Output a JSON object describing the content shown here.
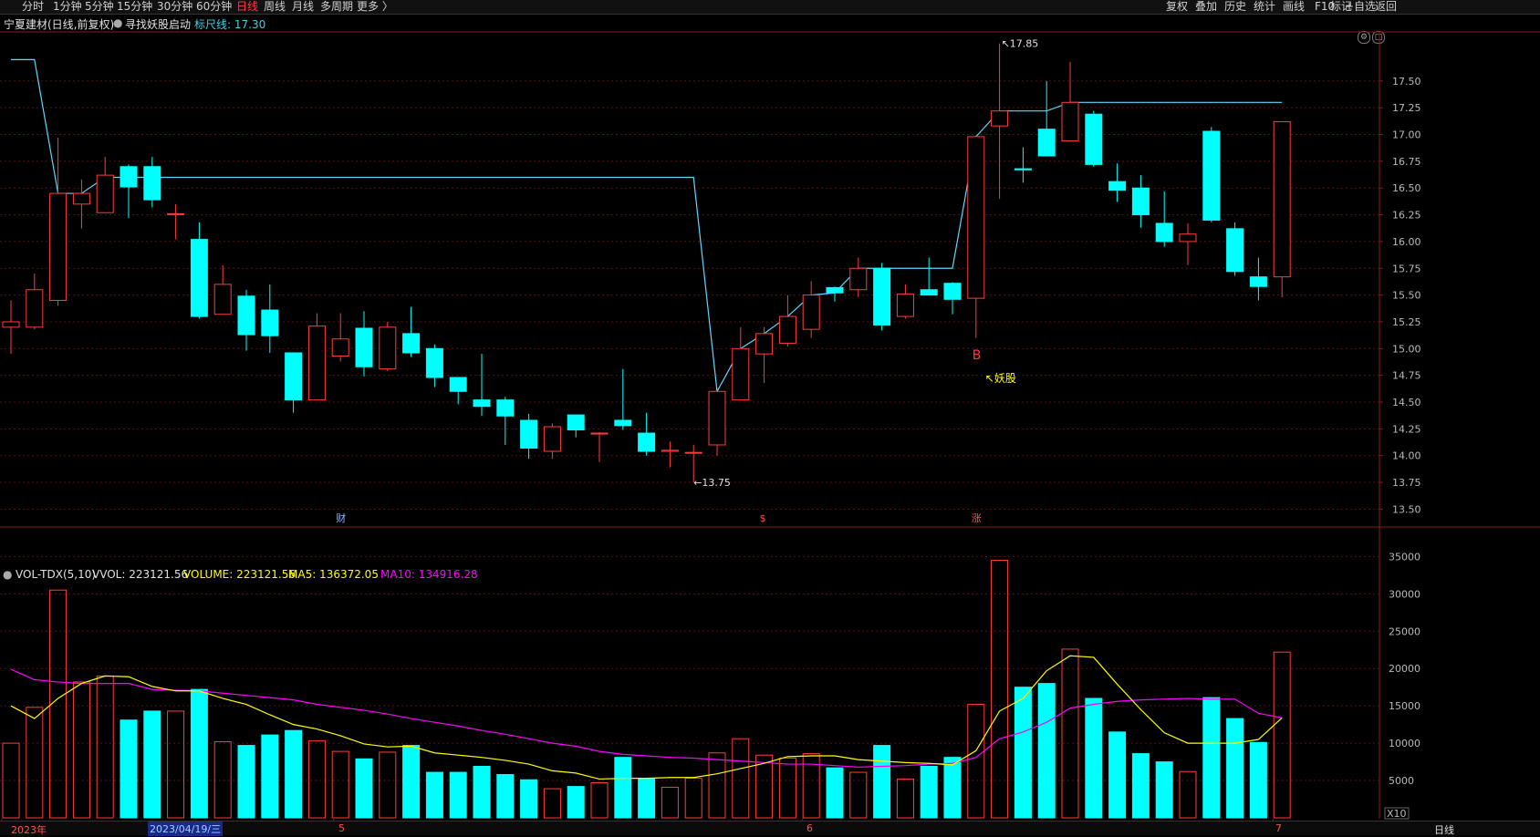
{
  "topbar": {
    "periods": [
      "分时",
      "1分钟",
      "5分钟",
      "15分钟",
      "30分钟",
      "60分钟",
      "日线",
      "周线",
      "月线",
      "多周期",
      "更多 〉"
    ],
    "active_period": "日线",
    "tools": [
      "复权",
      "叠加",
      "历史",
      "统计",
      "画线",
      "F10",
      "+自选",
      "返回"
    ],
    "mark_label": "标记"
  },
  "header": {
    "stock": "宁夏建材(日线,前复权)",
    "indicator": "寻找妖股启动",
    "ruler_label": "标尺线: 17.30"
  },
  "price_axis": [
    "17.50",
    "17.25",
    "17.00",
    "16.75",
    "16.50",
    "16.25",
    "16.00",
    "15.75",
    "15.50",
    "15.25",
    "15.00",
    "14.75",
    "14.50",
    "14.25",
    "14.00",
    "13.75",
    "13.50"
  ],
  "vol_axis": [
    "35000",
    "30000",
    "25000",
    "20000",
    "15000",
    "10000",
    "5000"
  ],
  "annotations": {
    "high": "17.85",
    "low": "13.75",
    "signal": "B",
    "signal_note": "↖妖股",
    "markers": [
      "财",
      "$",
      "涨"
    ]
  },
  "volume_legend": {
    "name": "VOL-TDX(5,10)",
    "vvol": "VVOL: 223121.56",
    "volume": "VOLUME: 223121.56",
    "ma5": "MA5: 136372.05",
    "ma10": "MA10: 134916.28"
  },
  "bottom": {
    "year": "2023年",
    "date": "2023/04/19/三",
    "months": [
      "5",
      "6",
      "7"
    ],
    "scale": "X10",
    "period": "日线"
  },
  "colors": {
    "up": "#ff3c3c",
    "down": "#00ffff",
    "ma5": "#ffff00",
    "ma10": "#ff00ff",
    "ruler": "#5fd7ff"
  },
  "chart_data": {
    "type": "candlestick",
    "candles": [
      [
        15.2,
        15.25,
        15.45,
        14.95
      ],
      [
        15.2,
        15.55,
        15.7,
        15.18
      ],
      [
        15.45,
        16.45,
        16.97,
        15.4
      ],
      [
        16.35,
        16.45,
        16.58,
        16.12
      ],
      [
        16.27,
        16.62,
        16.79,
        16.27
      ],
      [
        16.7,
        16.51,
        16.72,
        16.22
      ],
      [
        16.7,
        16.39,
        16.79,
        16.32
      ],
      [
        16.26,
        16.26,
        16.35,
        16.02
      ],
      [
        16.02,
        15.3,
        16.18,
        15.28
      ],
      [
        15.32,
        15.6,
        15.78,
        15.32
      ],
      [
        15.49,
        15.13,
        15.55,
        14.98
      ],
      [
        15.36,
        15.12,
        15.6,
        14.96
      ],
      [
        14.96,
        14.52,
        14.96,
        14.4
      ],
      [
        14.52,
        15.21,
        15.33,
        14.52
      ],
      [
        14.93,
        15.09,
        15.33,
        14.88
      ],
      [
        15.19,
        14.83,
        15.35,
        14.74
      ],
      [
        14.81,
        15.2,
        15.25,
        14.79
      ],
      [
        15.14,
        14.96,
        15.39,
        14.92
      ],
      [
        15.0,
        14.73,
        15.04,
        14.64
      ],
      [
        14.73,
        14.6,
        14.73,
        14.48
      ],
      [
        14.52,
        14.46,
        14.95,
        14.37
      ],
      [
        14.52,
        14.37,
        14.55,
        14.1
      ],
      [
        14.33,
        14.07,
        14.39,
        13.97
      ],
      [
        14.04,
        14.27,
        14.3,
        13.97
      ],
      [
        14.38,
        14.24,
        14.38,
        14.17
      ],
      [
        14.21,
        14.21,
        14.22,
        13.94
      ],
      [
        14.33,
        14.28,
        14.81,
        14.24
      ],
      [
        14.21,
        14.04,
        14.4,
        14.0
      ],
      [
        14.04,
        14.05,
        14.13,
        13.89
      ],
      [
        14.03,
        14.03,
        14.1,
        13.75
      ],
      [
        14.1,
        14.6,
        14.6,
        14.0
      ],
      [
        14.52,
        15.0,
        15.2,
        14.52
      ],
      [
        14.95,
        15.14,
        15.2,
        14.68
      ],
      [
        15.05,
        15.3,
        15.5,
        15.02
      ],
      [
        15.18,
        15.5,
        15.63,
        15.1
      ],
      [
        15.57,
        15.52,
        15.58,
        15.44
      ],
      [
        15.55,
        15.75,
        15.85,
        15.48
      ],
      [
        15.75,
        15.22,
        15.8,
        15.17
      ],
      [
        15.3,
        15.51,
        15.6,
        15.28
      ],
      [
        15.55,
        15.5,
        15.85,
        15.5
      ],
      [
        15.61,
        15.46,
        15.62,
        15.32
      ],
      [
        15.47,
        16.98,
        16.98,
        15.1
      ],
      [
        17.08,
        17.22,
        17.85,
        16.4
      ],
      [
        16.68,
        16.67,
        16.88,
        16.55
      ],
      [
        17.05,
        16.8,
        17.5,
        16.8
      ],
      [
        16.94,
        17.3,
        17.68,
        16.94
      ],
      [
        17.19,
        16.72,
        17.22,
        16.7
      ],
      [
        16.56,
        16.48,
        16.73,
        16.37
      ],
      [
        16.5,
        16.25,
        16.62,
        16.13
      ],
      [
        16.17,
        16.0,
        16.47,
        15.95
      ],
      [
        16.0,
        16.07,
        16.17,
        15.78
      ],
      [
        17.03,
        16.2,
        17.07,
        16.18
      ],
      [
        16.12,
        15.72,
        16.18,
        15.68
      ],
      [
        15.67,
        15.58,
        15.85,
        15.45
      ],
      [
        15.67,
        17.12,
        17.12,
        15.48
      ]
    ],
    "volumes": [
      10000,
      14800,
      30500,
      18200,
      19000,
      13100,
      14300,
      14300,
      17200,
      10200,
      9700,
      11100,
      11700,
      10300,
      8900,
      7900,
      8800,
      9700,
      6100,
      6100,
      6900,
      5800,
      5100,
      3900,
      4200,
      4700,
      8100,
      5300,
      4100,
      5300,
      8700,
      10600,
      8400,
      8000,
      8600,
      6700,
      6100,
      9700,
      5200,
      6900,
      8100,
      15200,
      34500,
      17500,
      18000,
      22600,
      16000,
      11500,
      8600,
      7500,
      6200,
      16100,
      13300,
      10100,
      22200
    ],
    "ma5": [
      15000,
      13300,
      16000,
      18000,
      19000,
      18900,
      17600,
      17000,
      17000,
      16000,
      15200,
      13800,
      12500,
      11900,
      11000,
      9900,
      9500,
      9600,
      8700,
      8400,
      8100,
      7700,
      7200,
      6300,
      6000,
      5200,
      5300,
      5300,
      5400,
      5400,
      5900,
      6600,
      7300,
      8200,
      8300,
      8300,
      7800,
      7600,
      7400,
      7300,
      7100,
      9000,
      14300,
      16000,
      19700,
      21700,
      21500,
      17900,
      14500,
      11400,
      10000,
      10000,
      10000,
      10500,
      13400
    ],
    "ma10": [
      19900,
      18500,
      18200,
      18000,
      18000,
      18000,
      17200,
      17100,
      17000,
      16700,
      16400,
      16100,
      15800,
      15200,
      14800,
      14400,
      13900,
      13300,
      12800,
      12300,
      11700,
      11200,
      10600,
      10000,
      9600,
      8900,
      8500,
      8300,
      8100,
      8000,
      7800,
      7600,
      7400,
      7200,
      7200,
      7000,
      6800,
      6900,
      7000,
      7200,
      7300,
      8100,
      10600,
      11500,
      12800,
      14700,
      15200,
      15600,
      15800,
      15900,
      16000,
      15900,
      15900,
      14000,
      13400
    ],
    "ruler": [
      17.7,
      17.7,
      16.45,
      16.45,
      16.6,
      16.6,
      16.6,
      16.6,
      16.6,
      16.6,
      16.6,
      16.6,
      16.6,
      16.6,
      16.6,
      16.6,
      16.6,
      16.6,
      16.6,
      16.6,
      16.6,
      16.6,
      16.6,
      16.6,
      16.6,
      16.6,
      16.6,
      16.6,
      16.6,
      16.6,
      14.6,
      15.0,
      15.14,
      15.3,
      15.5,
      15.52,
      15.75,
      15.75,
      15.75,
      15.75,
      15.75,
      16.98,
      17.22,
      17.22,
      17.22,
      17.3,
      17.3,
      17.3,
      17.3,
      17.3,
      17.3,
      17.3,
      17.3,
      17.3,
      17.3
    ],
    "ylim_price": [
      13.35,
      17.95
    ],
    "ylim_volume": [
      0,
      37000
    ]
  }
}
